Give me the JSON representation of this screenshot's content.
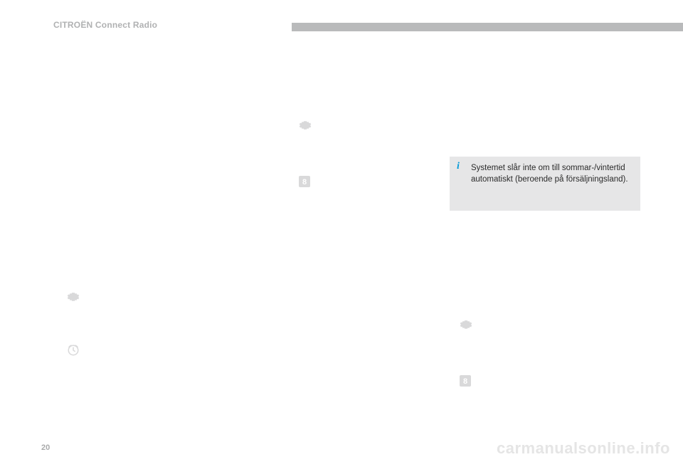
{
  "header": {
    "title": "CITROËN Connect Radio"
  },
  "page_number": "20",
  "watermark": "carmanualsonline.info",
  "info_box": {
    "text": "Systemet slår inte om till sommar-/vintertid automatiskt (beroende på försäljningsland)."
  },
  "icons": {
    "gear": "gear-icon",
    "clock": "clock-icon",
    "box8": "box8-icon"
  }
}
